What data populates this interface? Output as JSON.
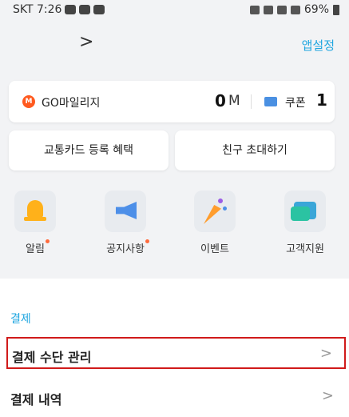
{
  "status_bar": {
    "carrier_time": "SKT 7:26",
    "battery": "69%"
  },
  "header": {
    "app_settings": "앱설정"
  },
  "mileage": {
    "label": "GO마일리지",
    "icon_text": "M",
    "value": "0",
    "unit": "M",
    "coupon_label": "쿠폰",
    "coupon_value": "1"
  },
  "buttons": {
    "transit_card": "교통카드 등록 혜택",
    "invite": "친구 초대하기"
  },
  "quick_menu": [
    {
      "label": "알림",
      "icon": "bell-icon",
      "has_dot": true
    },
    {
      "label": "공지사항",
      "icon": "megaphone-icon",
      "has_dot": true
    },
    {
      "label": "이벤트",
      "icon": "party-popper-icon",
      "has_dot": false
    },
    {
      "label": "고객지원",
      "icon": "chat-bubble-icon",
      "has_dot": false
    }
  ],
  "payment_section": {
    "title": "결제",
    "items": [
      {
        "label": "결제 수단 관리"
      },
      {
        "label": "결제 내역"
      }
    ]
  },
  "colors": {
    "accent": "#1fa6e0",
    "highlight_border": "#d01a1a",
    "notification_dot": "#ff6b3d"
  }
}
